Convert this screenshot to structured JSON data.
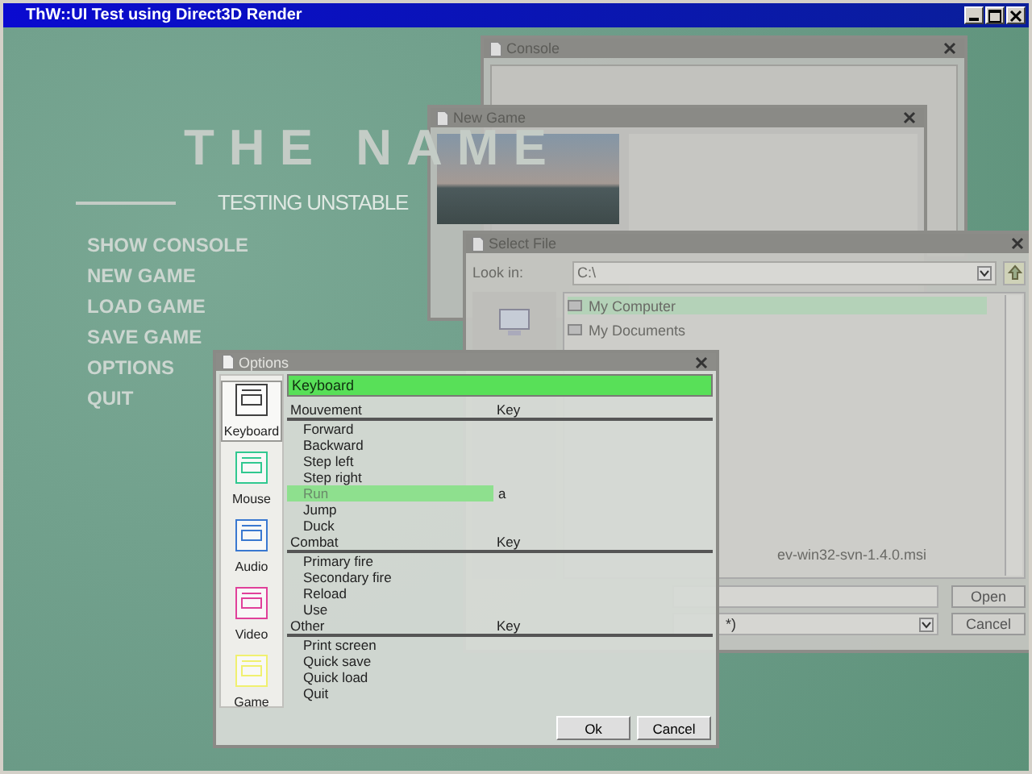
{
  "window": {
    "title": "ThW::UI Test using Direct3D Render"
  },
  "game_title": "THE NAME",
  "subtitle": "TESTING UNSTABLE",
  "main_menu": [
    "SHOW CONSOLE",
    "NEW GAME",
    "LOAD GAME",
    "SAVE GAME",
    "OPTIONS",
    "QUIT"
  ],
  "console_window": {
    "title": "Console"
  },
  "new_game_window": {
    "title": "New Game"
  },
  "select_file_window": {
    "title": "Select File",
    "look_in_label": "Look in:",
    "path": "C:\\",
    "items": [
      {
        "label": "My Computer",
        "selected": true
      },
      {
        "label": "My Documents",
        "selected": false
      }
    ],
    "partial_item": "ev-win32-svn-1.4.0.msi",
    "type_value": "*)",
    "buttons": [
      "Open",
      "Cancel"
    ]
  },
  "options_window": {
    "title": "Options",
    "categories": [
      {
        "label": "Keyboard",
        "color": "#404040",
        "selected": true
      },
      {
        "label": "Mouse",
        "color": "#30c890",
        "selected": false
      },
      {
        "label": "Audio",
        "color": "#3a78d0",
        "selected": false
      },
      {
        "label": "Video",
        "color": "#e0409a",
        "selected": false
      },
      {
        "label": "Game",
        "color": "#f0f070",
        "selected": false
      }
    ],
    "header": "Keyboard",
    "sections": [
      {
        "name": "Mouvement",
        "key_header": "Key",
        "actions": [
          {
            "label": "Forward",
            "selected": false
          },
          {
            "label": "Backward",
            "selected": false
          },
          {
            "label": "Step left",
            "selected": false
          },
          {
            "label": "Step right",
            "selected": false
          },
          {
            "label": "Run",
            "key": "a",
            "selected": true
          },
          {
            "label": "Jump",
            "selected": false
          },
          {
            "label": "Duck",
            "selected": false
          }
        ]
      },
      {
        "name": "Combat",
        "key_header": "Key",
        "actions": [
          {
            "label": "Primary fire",
            "selected": false
          },
          {
            "label": "Secondary fire",
            "selected": false
          },
          {
            "label": "Reload",
            "selected": false
          },
          {
            "label": "Use",
            "selected": false
          }
        ]
      },
      {
        "name": "Other",
        "key_header": "Key",
        "actions": [
          {
            "label": "Print screen",
            "selected": false
          },
          {
            "label": "Quick save",
            "selected": false
          },
          {
            "label": "Quick load",
            "selected": false
          },
          {
            "label": "Quit",
            "selected": false
          }
        ]
      }
    ],
    "buttons": [
      "Ok",
      "Cancel"
    ]
  }
}
